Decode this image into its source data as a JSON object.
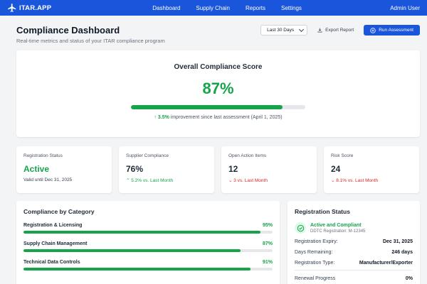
{
  "nav": {
    "logo": "ITAR.APP",
    "links": [
      "Dashboard",
      "Supply Chain",
      "Reports",
      "Settings"
    ],
    "user": "Admin User"
  },
  "header": {
    "title": "Compliance Dashboard",
    "subtitle": "Real-time metrics and status of your ITAR compliance program",
    "range": "Last 30 Days",
    "export_label": "Export Report",
    "run_label": "Run Assessment"
  },
  "score": {
    "title": "Overall Compliance Score",
    "value": "87%",
    "fraction": 0.87,
    "note_arrow": "↑",
    "note_delta": "3.5%",
    "note_text": " improvement since last assessment (April 1, 2025)"
  },
  "metrics": [
    {
      "label": "Registration Status",
      "value": "Active",
      "sub": "Valid until Dec 31, 2025"
    },
    {
      "label": "Supplier Compliance",
      "value": "76%",
      "sub": "5.2% vs. Last Month"
    },
    {
      "label": "Open Action Items",
      "value": "12",
      "sub": "3 vs. Last Month"
    },
    {
      "label": "Risk Score",
      "value": "24",
      "sub": "8.1% vs. Last Month"
    }
  ],
  "categories": {
    "title": "Compliance by Category",
    "items": [
      {
        "name": "Registration & Licensing",
        "pct": "95%",
        "fraction": 0.95
      },
      {
        "name": "Supply Chain Management",
        "pct": "87%",
        "fraction": 0.87
      },
      {
        "name": "Technical Data Controls",
        "pct": "91%",
        "fraction": 0.91
      },
      {
        "name": "",
        "pct": "",
        "fraction": 0.0
      }
    ]
  },
  "registration": {
    "title": "Registration Status",
    "status": "Active and Compliant",
    "number": "DDTC Registration: M-12345",
    "rows": [
      {
        "k": "Registration Expiry:",
        "v": "Dec 31, 2025"
      },
      {
        "k": "Days Remaining:",
        "v": "246 days"
      },
      {
        "k": "Registration Type:",
        "v": "Manufacturer/Exporter"
      },
      {
        "k": "Renewal Progress",
        "v": "0%"
      }
    ]
  },
  "colors": {
    "brand": "#1a56db",
    "success": "#16a34a",
    "danger": "#dc2626"
  }
}
